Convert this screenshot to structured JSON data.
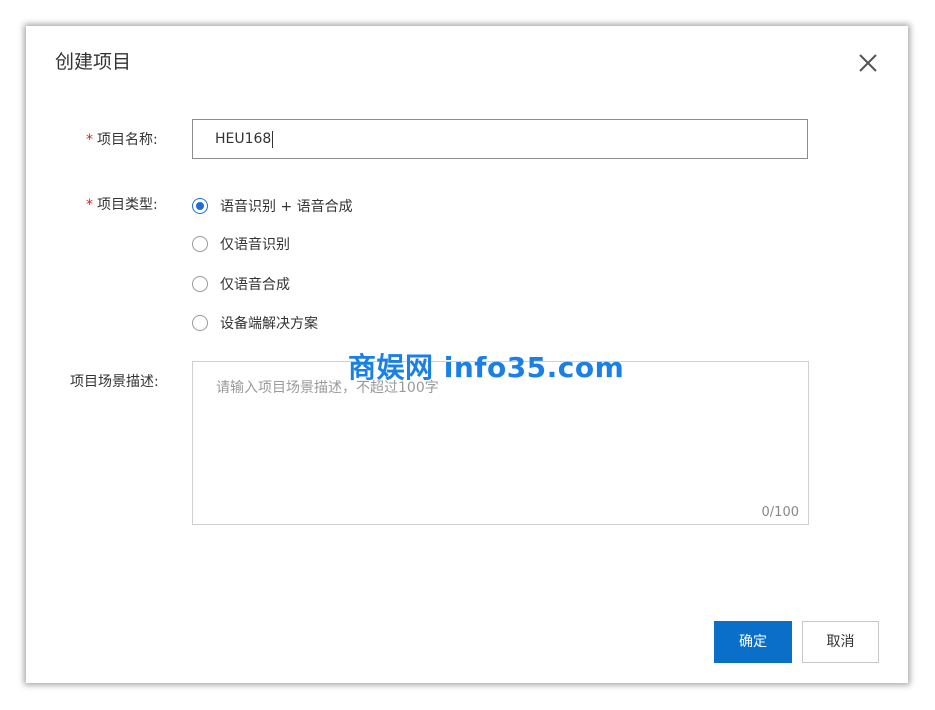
{
  "dialog": {
    "title": "创建项目",
    "close_icon": "close-icon"
  },
  "form": {
    "name": {
      "required_mark": "*",
      "label": "项目名称:",
      "value": "HEU168"
    },
    "type": {
      "required_mark": "*",
      "label": "项目类型:",
      "options": [
        {
          "label": "语音识别 + 语音合成",
          "checked": true
        },
        {
          "label": "仅语音识别",
          "checked": false
        },
        {
          "label": "仅语音合成",
          "checked": false
        },
        {
          "label": "设备端解决方案",
          "checked": false
        }
      ]
    },
    "description": {
      "label": "项目场景描述:",
      "placeholder": "请输入项目场景描述，不超过100字",
      "counter": "0/100"
    }
  },
  "watermark": "商娱网 info35.com",
  "footer": {
    "ok_label": "确定",
    "cancel_label": "取消"
  },
  "colors": {
    "primary": "#0a6fc9",
    "required": "#e02020",
    "watermark": "#1a7fe6"
  }
}
